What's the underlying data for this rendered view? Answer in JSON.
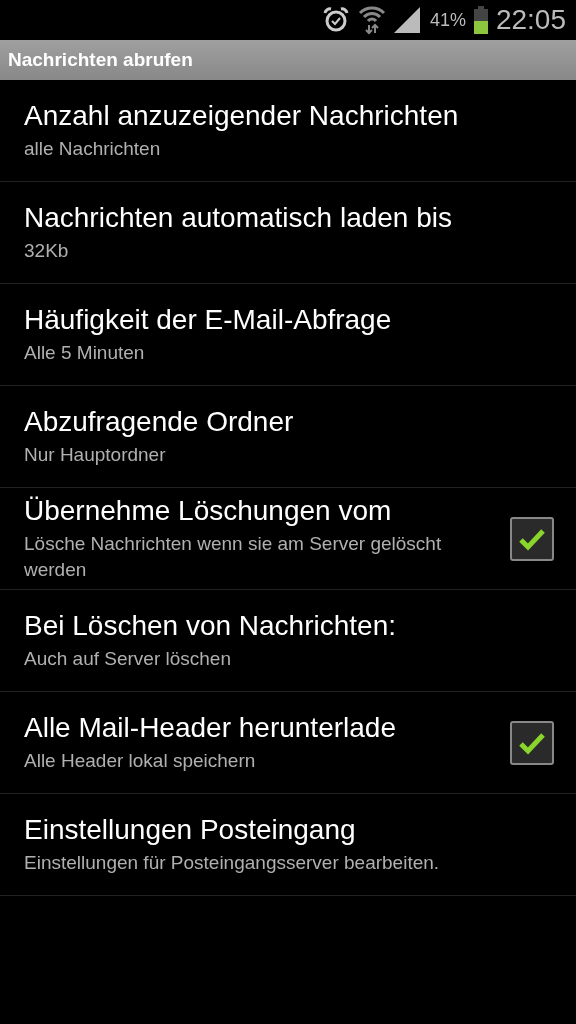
{
  "status_bar": {
    "battery_percent": "41%",
    "time": "22:05"
  },
  "section_header": "Nachrichten abrufen",
  "settings": [
    {
      "kind": "plain",
      "title": "Anzahl anzuzeigender Nachrichten",
      "summary": "alle Nachrichten"
    },
    {
      "kind": "plain",
      "title": "Nachrichten automatisch laden bis",
      "summary": "32Kb"
    },
    {
      "kind": "plain",
      "title": "Häufigkeit der E-Mail-Abfrage",
      "summary": "Alle 5 Minuten"
    },
    {
      "kind": "plain",
      "title": "Abzufragende Ordner",
      "summary": "Nur Hauptordner"
    },
    {
      "kind": "checkbox",
      "title": "Übernehme Löschungen vom",
      "summary": "Lösche Nachrichten wenn sie am Server gelöscht werden",
      "checked": true
    },
    {
      "kind": "plain",
      "title": "Bei Löschen von Nachrichten:",
      "summary": "Auch auf Server löschen"
    },
    {
      "kind": "checkbox",
      "title": "Alle Mail-Header herunterlade",
      "summary": "Alle Header lokal speichern",
      "checked": true
    },
    {
      "kind": "plain",
      "title": "Einstellungen Posteingang",
      "summary": "Einstellungen für Posteingangsserver bearbeiten."
    }
  ]
}
